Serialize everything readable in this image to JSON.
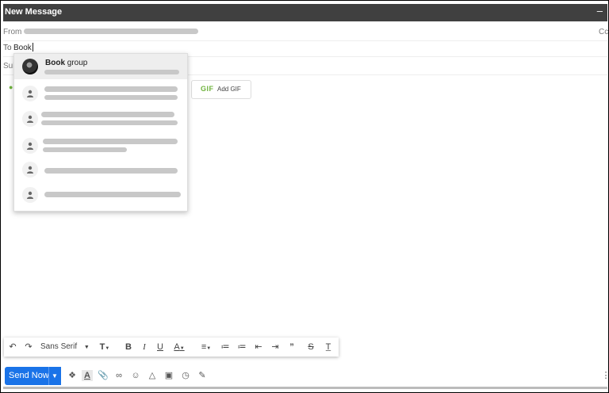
{
  "window": {
    "title": "New Message",
    "minimize_icon": "minimize-icon"
  },
  "from": {
    "label": "From"
  },
  "cc": {
    "label": "Cc"
  },
  "to": {
    "label": "To",
    "value": "Book"
  },
  "subject": {
    "label": "Sub"
  },
  "autocomplete": {
    "first": {
      "name_bold": "Book",
      "name_rest": " group"
    }
  },
  "gif": {
    "icon_text": "GIF",
    "label": "Add GIF"
  },
  "format_bar": {
    "font": "Sans Serif",
    "icons": [
      "undo-icon",
      "redo-icon",
      "font-size-icon",
      "bold-icon",
      "italic-icon",
      "underline-icon",
      "text-color-icon",
      "align-icon",
      "numbered-list-icon",
      "bulleted-list-icon",
      "indent-less-icon",
      "indent-more-icon",
      "quote-icon",
      "strikethrough-icon",
      "remove-formatting-icon"
    ]
  },
  "send": {
    "label": "Send Now",
    "icons": [
      "dropbox-icon",
      "formatting-icon",
      "attach-icon",
      "link-icon",
      "emoji-icon",
      "drive-icon",
      "photo-icon",
      "lock-clock-icon",
      "signature-icon",
      "more-icon"
    ]
  },
  "colors": {
    "titlebar": "#404040",
    "send": "#1a73e8",
    "gif_green": "#6fb33d"
  }
}
